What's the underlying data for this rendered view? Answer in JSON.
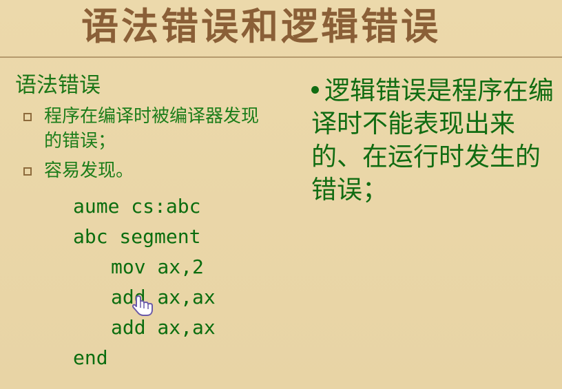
{
  "slide": {
    "title": "语法错误和逻辑错误",
    "left": {
      "heading": "语法错误",
      "bullets": [
        "程序在编译时被编译器发现的错误；",
        "容易发现。"
      ],
      "code_lines": [
        "aume cs:abc",
        "abc segment",
        "mov ax,2",
        "add ax,ax",
        "add ax,ax",
        "end"
      ]
    },
    "right": {
      "text": "逻辑错误是程序在编译时不能表现出来的、在运行时发生的错误；"
    },
    "cursor_icon": "pointing-hand-icon"
  },
  "colors": {
    "title": "#8a5f37",
    "text": "#116c12",
    "background": "#ead7a9",
    "bullet_box": "#8d6a3b"
  }
}
